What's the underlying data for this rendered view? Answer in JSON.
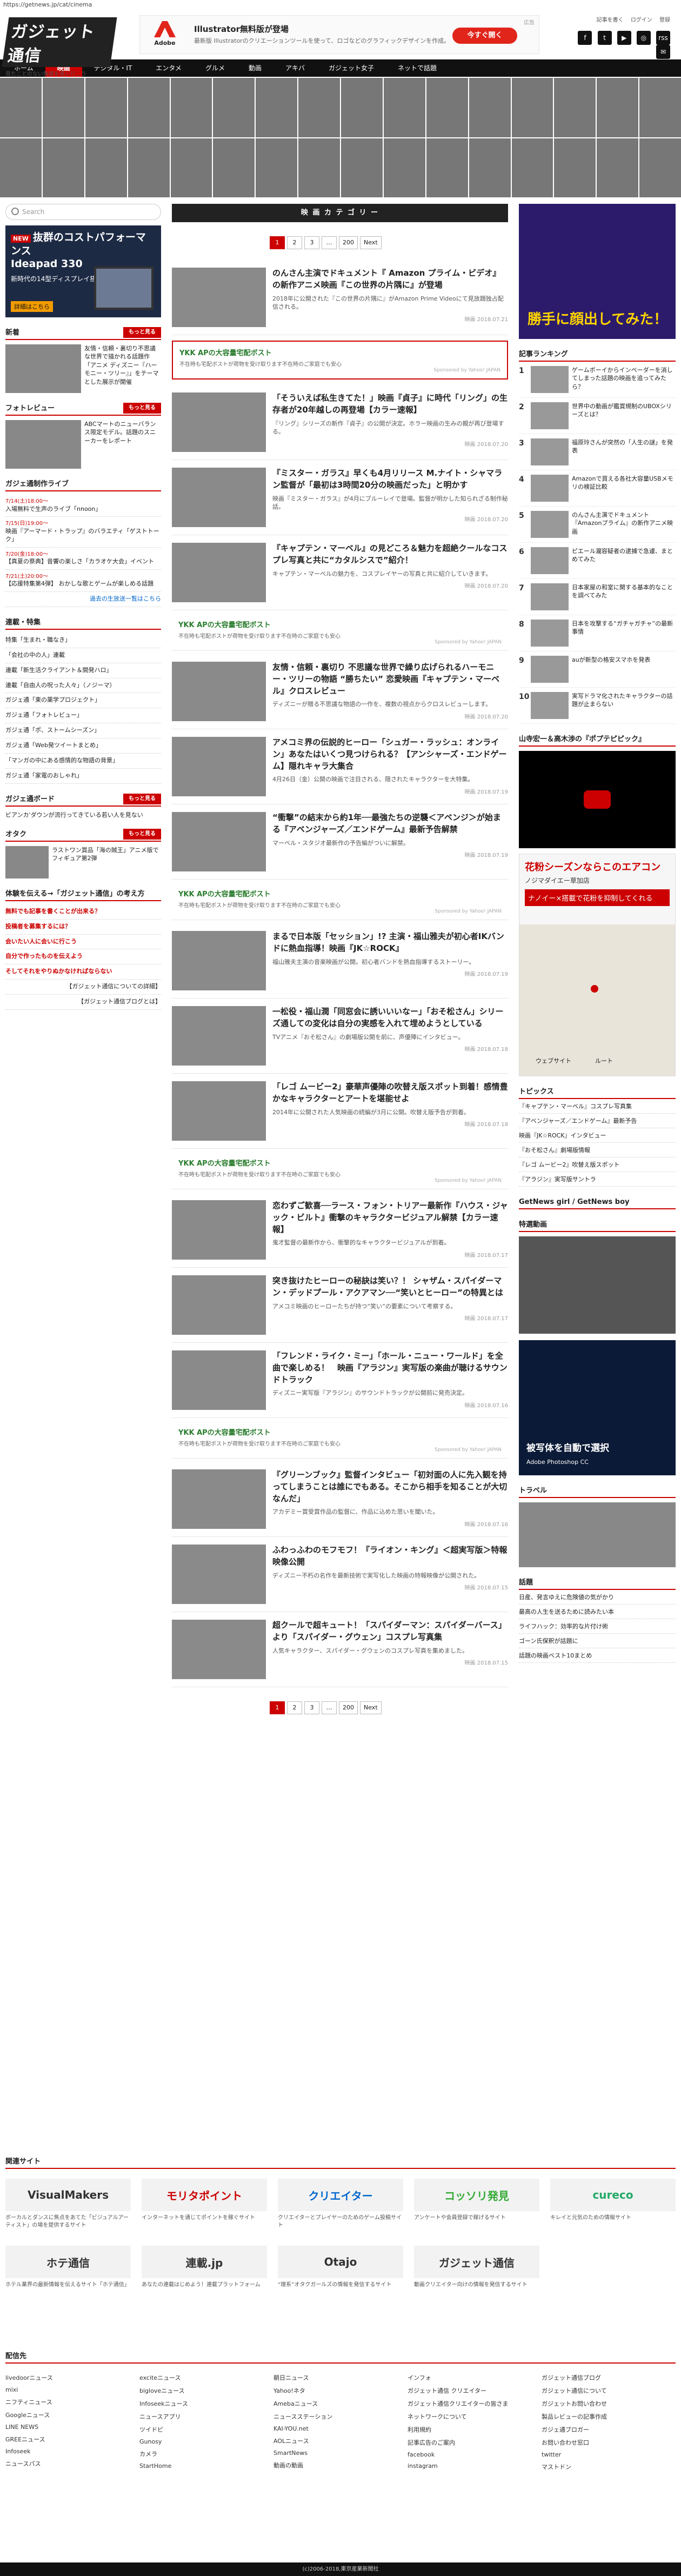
{
  "url": "https://getnews.jp/cat/cinema",
  "header": {
    "logo": "ガジェット通信",
    "logo_sub": "見たことのない角度を見に行こう",
    "ad": {
      "brand": "Adobe",
      "title": "Illustrator無料版が登場",
      "desc": "最新版 Illustratorのクリエーションツールを使って、ロゴなどのグラフィックデザインを作成。",
      "button": "今すぐ開く",
      "close": "広告"
    },
    "links": [
      "記事を書く",
      "ログイン",
      "登録"
    ],
    "social": [
      "f",
      "t",
      "▶",
      "◎",
      "rss",
      "✉"
    ]
  },
  "nav": [
    "ホーム",
    "映画",
    "デジタル・IT",
    "エンタメ",
    "グルメ",
    "動画",
    "アキバ",
    "ガジェット女子",
    "ネットで話題"
  ],
  "left": {
    "search_placeholder": "Search",
    "ad": {
      "badge": "NEW",
      "big": "抜群のコストパフォーマンス",
      "model": "Ideapad 330",
      "small": "新時代の14型ディスプレイ搭載",
      "tag": "詳細はこちら"
    },
    "news": {
      "title": "新着",
      "more": "もっと見る",
      "item": "友情・信頼・裏切り不思議な世界で描かれる話題作「アニメ ディズニー『ハーモニー・ツリー』」をテーマとした展示が開催"
    },
    "photo": {
      "title": "フォトレビュー",
      "more": "もっと見る",
      "item": "ABCマートのニューバランス限定モデル。話題のスニーカーをレポート"
    },
    "live": {
      "title": "ガジェ通制作ライブ",
      "items": [
        {
          "date": "7/14(土)18:00〜",
          "text": "入場無料で生声のライブ「nnoon」"
        },
        {
          "date": "7/15(日)19:00〜",
          "text": "映画『アーマード・トラップ』のバラエティ「ゲストトーク」"
        },
        {
          "date": "7/20(金)18:00〜",
          "text": "【真夏の祭典】音響の楽しさ「カラオケ大会」イベント"
        },
        {
          "date": "7/21(土)20:00〜",
          "text": "【応援特集第4弾】 おかしな歌とゲームが楽しめる話題"
        }
      ],
      "more": "過去の生放送一覧はこちら"
    },
    "special": {
      "title": "連載・特集",
      "items": [
        "特集「生まれ・職なき」",
        "「会社の中の人」連載",
        "連載「新生活クライアント＆開発ハロ」",
        "連載「自由人の呪った人々」（ノジーマ）",
        "ガジェ通「東の薬学プロジェクト」",
        "ガジェ通「フォトレビュー」",
        "ガジェ通「ポ、ストームシーズン」",
        "ガジェ通「Web発ツイートまとめ」",
        "「マンガの中にある感情的な物語の背景」",
        "ガジェ通「家電のおしゃれ」"
      ]
    },
    "oddnews": {
      "title": "ガジェ通ボード",
      "more": "もっと見る",
      "text": "ビアンカ'ダウンが流行ってきている若い人を見ない"
    },
    "otaku": {
      "title": "オタク",
      "more": "もっと見る",
      "text": "ラストワン賞品「海の賊王」アニメ版でフィギュア第2弾"
    },
    "social_block": {
      "title": "体験を伝える→「ガジェット通信」の考え方",
      "items": [
        "無料でも記事を書くことが出来る？",
        "投稿者を募集するには？",
        "会いたい人に会いに行こう",
        "自分で作ったものを伝えよう",
        "そしてそれをやりぬかなければならない"
      ],
      "more1": "【ガジェット通信についての詳細】",
      "more2": "【ガジェット通信ブログとは】"
    }
  },
  "main": {
    "category": "映 画 カ テ ゴ リ ー",
    "pager": [
      "1",
      "2",
      "3",
      "…",
      "200",
      "Next"
    ],
    "ykk": {
      "title": "YKK APの大容量宅配ボスト",
      "desc": "不在時も宅配ボストが荷物を受け取ります不在時のご家庭でも安心",
      "pr": "Sponsored by Yahoo! JAPAN"
    },
    "articles": [
      {
        "title": "のんさん主演でドキュメント『 Amazon プライム・ビデオ』の新作アニメ映画『この世界の片隅に』が登場",
        "desc": "2018年に公開された『この世界の片隅に』がAmazon Prime Videoにて見放題独占配信される。",
        "meta": "映画 2018.07.21"
      },
      {
        "title": "「そういえば私生きてた！」映画『貞子』に時代「リング」の生存者が20年越しの再登場【カラー速報】",
        "desc": "『リング』シリーズの新作『貞子』の公開が決定。ホラー映画の生みの親が再び登場する。",
        "meta": "映画 2018.07.20"
      },
      {
        "title": "『ミスター・ガラス』早くも4月リリース M.ナイト・シャマラン監督が「最初は3時間20分の映画だった」と明かす",
        "desc": "映画『ミスター・ガラス』が4月にブルーレイで登場。監督が明かした知られざる制作秘話。",
        "meta": "映画 2018.07.20"
      },
      {
        "title": "『キャプテン・マーベル』の見どころ＆魅力を超絶クールなコスプレ写真と共に“カタルシスで”紹介！",
        "desc": "キャプテン・マーベルの魅力を、コスプレイヤーの写真と共に紹介していきます。",
        "meta": "映画 2018.07.20"
      },
      {
        "title": "友情・信頼・裏切り 不思議な世界で繰り広げられるハーモニー・ツリーの物語 “勝ちたい” 恋愛映画『キャプテン・マーベル』クロスレビュー",
        "desc": "ディズニーが贈る不思議な物語の一作を、複数の視点からクロスレビューします。",
        "meta": "映画 2018.07.20"
      },
      {
        "title": "アメコミ界の伝説的ヒーロー「シュガー・ラッシュ：オンライン」あなたはいくつ見つけられる？【アンシャーズ・エンドゲーム】隠れキャラ大集合",
        "desc": "4月26日（金）公開の映画で注目される、隠されたキャラクターを大特集。",
        "meta": "映画 2018.07.19"
      },
      {
        "title": "“衝撃”の結末から約1年──最強たちの逆襲＜アベンジ＞が始まる『アベンジャーズ／エンドゲーム』最新予告解禁",
        "desc": "マーベル・スタジオ最新作の予告編がついに解禁。",
        "meta": "映画 2018.07.19"
      },
      {
        "title": "まるで日本版「セッション」!? 主演・福山雅夫が初心者IKバンドに熱血指導！映画『JK☆ROCK』",
        "desc": "福山雅夫主演の音楽映画が公開。初心者バンドを熱血指導するストーリー。",
        "meta": "映画 2018.07.19"
      },
      {
        "title": "一松役・福山潤「同窓会に誘いいいなー」「おそ松さん」シリーズ通しての変化は自分の実感を入れて埋めようとしている",
        "desc": "TVアニメ『おそ松さん』の劇場版公開を前に、声優陣にインタビュー。",
        "meta": "映画 2018.07.18"
      },
      {
        "title": "「レゴ ムービー2」豪華声優陣の吹替え版スポット到着！感情豊かなキャラクターとアートを堪能せよ",
        "desc": "2014年に公開された人気映画の続編が3月に公開。吹替え版予告が到着。",
        "meta": "映画 2018.07.18"
      },
      {
        "title": "恋わずご歓喜──ラース・フォン・トリアー最新作『ハウス・ジャック・ビルト』衝撃のキャラクタービジュアル解禁【カラー速報】",
        "desc": "鬼才監督の最新作から、衝撃的なキャラクタービジュアルが到着。",
        "meta": "映画 2018.07.17"
      },
      {
        "title": "突き抜けたヒーローの秘訣は笑い？！ シャザム・スパイダーマン・デッドプール・アクアマン──“笑いとヒーロー”の特異とは",
        "desc": "アメコミ映画のヒーローたちが持つ“笑い”の要素について考察する。",
        "meta": "映画 2018.07.17"
      },
      {
        "title": "「フレンド・ライク・ミー」「ホール・ニュー・ワールド」を全曲で楽しめる！　映画『アラジン』実写版の楽曲が聴けるサウンドトラック",
        "desc": "ディズニー実写版『アラジン』のサウンドトラックが公開前に発売決定。",
        "meta": "映画 2018.07.16"
      },
      {
        "title": "『グリーンブック』監督インタビュー「初対面の人に先入観を持ってしまうことは誰にでもある。そこから相手を知ることが大切なんだ」",
        "desc": "アカデミー賞受賞作品の監督に、作品に込めた思いを聞いた。",
        "meta": "映画 2018.07.16"
      },
      {
        "title": "ふわっふわのモフモフ！『ライオン・キング』＜超実写版＞特報映像公開",
        "desc": "ディズニー不朽の名作を最新技術で実写化した映画の特報映像が公開された。",
        "meta": "映画 2018.07.15"
      },
      {
        "title": "超クールで超キュート！「スパイダーマン：スパイダーバース」より「スパイダー・グウェン」コスプレ写真集",
        "desc": "人気キャラクター、スパイダー・グウェンのコスプレ写真を集めました。",
        "meta": "映画 2018.07.15"
      }
    ]
  },
  "right": {
    "ad_title": "勝手に顔出してみた！",
    "ranking_title": "記事ランキング",
    "ranking": [
      "ゲームボーイからインベーダーを消してしまった話題の映画を追ってみたら？",
      "世界中の動画が鑑賞規制のUBOXシリーズとは？",
      "福原玲さんが突然の「人生の謎」を発表",
      "Amazonで買える各社大容量USBメモリの検証比較",
      "のんさん主演でドキュメント『Amazonプライム』の新作アニメ映画",
      "ピエール瀧容疑者の逮捕で急遽、まとめてみた",
      "日本家屋の和室に関する基本的なことを調べてみた",
      "日本を攻撃する“ガチャガチャ”の最新事情",
      "auが新型の格安スマホを発表",
      "実写ドラマ化されたキャラクターの話題が止まらない"
    ],
    "video_title": "山寺宏一＆高木渉の『ポプテピピック』",
    "map_ad": {
      "t1": "花粉シーズンならこのエアコン",
      "t2": "ノジマダイエー草加店",
      "t3": "ナノイー×搭載で花粉を抑制してくれる",
      "label1": "ウェブサイト",
      "label2": "ルート"
    },
    "topics_title": "トピックス",
    "topics": [
      "『キャプテン・マーベル』コスプレ写真集",
      "『アベンジャーズ／エンドゲーム』最新予告",
      "映画『JK☆ROCK』インタビュー",
      "『おそ松さん』劇場版情報",
      "『レゴ ムービー2』吹替え版スポット",
      "『アラジン』実写版サントラ"
    ],
    "getnews_girl": "GetNews girl / GetNews boy",
    "special_title": "特選動画",
    "adobe_ad": {
      "title": "被写体を自動で選択",
      "sub": "Adobe Photoshop CC"
    },
    "travel_title": "トラベル",
    "ranking2_title": "話題",
    "ranking2": [
      "日産、発言ゆえに危険値の気がかり",
      "最高の人生を送るために読みたい本",
      "ライフハック：効率的な片付け術",
      "ゴーン氏保釈が話題に",
      "話題の映画ベスト10まとめ"
    ]
  },
  "footer": {
    "related_title": "関連サイト",
    "sites": [
      {
        "name": "VisualMakers",
        "desc": "ボーカルとダンスに焦点をあてた「ビジュアルアーティスト」の場を提供するサイト"
      },
      {
        "name": "モリタポイント",
        "desc": "インターネットを通じてポイントを稼ぐサイト"
      },
      {
        "name": "クリエイター",
        "desc": "クリエイターとプレイヤーのためのゲーム投稿サイト"
      },
      {
        "name": "コッソリ発見",
        "desc": "アンケートや会員登録で稼げるサイト"
      },
      {
        "name": "cureco",
        "desc": "キレイと元気のための情報サイト"
      },
      {
        "name": "ホテ通信",
        "desc": "ホテル業界の最新情報を伝えるサイト「ホテ通信」"
      },
      {
        "name": "連載.jp",
        "desc": "あなたの連載はじめよう！連載プラットフォーム"
      },
      {
        "name": "Otajo",
        "desc": "“理系”オタクガールズの情報を発信するサイト"
      },
      {
        "name": "ガジェット通信",
        "desc": "動画クリエイター向けの情報を発信するサイト"
      }
    ],
    "partner_title": "配信先",
    "cols": [
      [
        "livedoorニュース",
        "mixi",
        "ニフティニュース",
        "Googleニュース",
        "LINE NEWS",
        "GREEニュース",
        "Infoseek",
        "ニュースパス"
      ],
      [
        "exciteニュース",
        "bigloveニュース",
        "Infoseekニュース",
        "ニュースアプリ",
        "ツイドビ",
        "Gunosy",
        "カメラ",
        "StartHome"
      ],
      [
        "朝日ニュース",
        "Yahoo!ネタ",
        "Amebaニュース",
        "ニュースステーション",
        "KAI-YOU.net",
        "AOLニュース",
        "SmartNews",
        "動画の動画"
      ],
      [
        "インフォ",
        "ガジェット通信 クリエイター",
        "ガジェット通信クリエイターの皆さま",
        "ネットワークについて",
        "利用規約",
        "記事広告のご案内",
        "facebook",
        "instagram"
      ],
      [
        "ガジェット通信ブログ",
        "ガジェット通信について",
        "ガジェットお問い合わせ",
        "製品レビューの記事作成",
        "ガジェ通ブロガー",
        "お問い合わせ窓口",
        "twitter",
        "マストドン"
      ]
    ],
    "copyright": "(c)2006-2018,東京産業新聞社"
  }
}
